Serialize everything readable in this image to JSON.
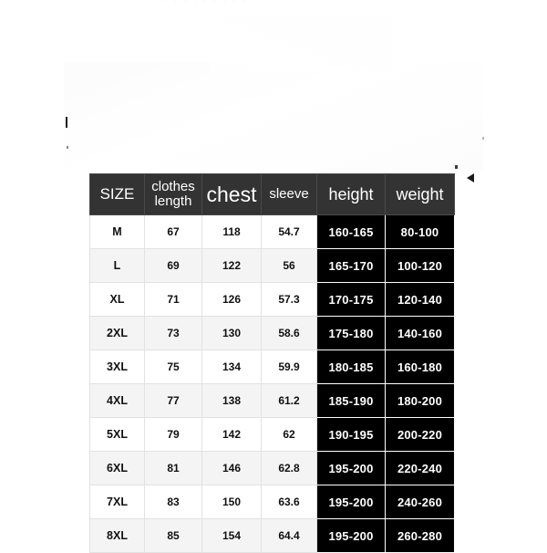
{
  "page": {
    "background_color": "#ffffff",
    "top_cut_text": "· ·  ·   ·    ·      ·       ·     ·    ·"
  },
  "size_chart": {
    "header_bg": "#333333",
    "header_text_color": "#ffffff",
    "highlight_bg": "#000000",
    "highlight_text_color": "#ffffff",
    "row_alt_bg": "#f4f4f4",
    "columns": [
      {
        "key": "size",
        "label": "SIZE",
        "label_lines": [
          "SIZE"
        ],
        "highlight": false
      },
      {
        "key": "clothes",
        "label": "clothes length",
        "label_lines": [
          "clothes",
          "length"
        ],
        "highlight": false
      },
      {
        "key": "chest",
        "label": "chest",
        "label_lines": [
          "chest"
        ],
        "highlight": false
      },
      {
        "key": "sleeve",
        "label": "sleeve",
        "label_lines": [
          "sleeve"
        ],
        "highlight": false
      },
      {
        "key": "height",
        "label": "height",
        "label_lines": [
          "height"
        ],
        "highlight": true
      },
      {
        "key": "weight",
        "label": "weight",
        "label_lines": [
          "weight"
        ],
        "highlight": true
      }
    ],
    "rows": [
      {
        "size": "M",
        "clothes": "67",
        "chest": "118",
        "sleeve": "54.7",
        "height": "160-165",
        "weight": "80-100"
      },
      {
        "size": "L",
        "clothes": "69",
        "chest": "122",
        "sleeve": "56",
        "height": "165-170",
        "weight": "100-120"
      },
      {
        "size": "XL",
        "clothes": "71",
        "chest": "126",
        "sleeve": "57.3",
        "height": "170-175",
        "weight": "120-140"
      },
      {
        "size": "2XL",
        "clothes": "73",
        "chest": "130",
        "sleeve": "58.6",
        "height": "175-180",
        "weight": "140-160"
      },
      {
        "size": "3XL",
        "clothes": "75",
        "chest": "134",
        "sleeve": "59.9",
        "height": "180-185",
        "weight": "160-180"
      },
      {
        "size": "4XL",
        "clothes": "77",
        "chest": "138",
        "sleeve": "61.2",
        "height": "185-190",
        "weight": "180-200"
      },
      {
        "size": "5XL",
        "clothes": "79",
        "chest": "142",
        "sleeve": "62",
        "height": "190-195",
        "weight": "200-220"
      },
      {
        "size": "6XL",
        "clothes": "81",
        "chest": "146",
        "sleeve": "62.8",
        "height": "195-200",
        "weight": "220-240"
      },
      {
        "size": "7XL",
        "clothes": "83",
        "chest": "150",
        "sleeve": "63.6",
        "height": "195-200",
        "weight": "240-260"
      },
      {
        "size": "8XL",
        "clothes": "85",
        "chest": "154",
        "sleeve": "64.4",
        "height": "195-200",
        "weight": "260-280"
      }
    ]
  }
}
